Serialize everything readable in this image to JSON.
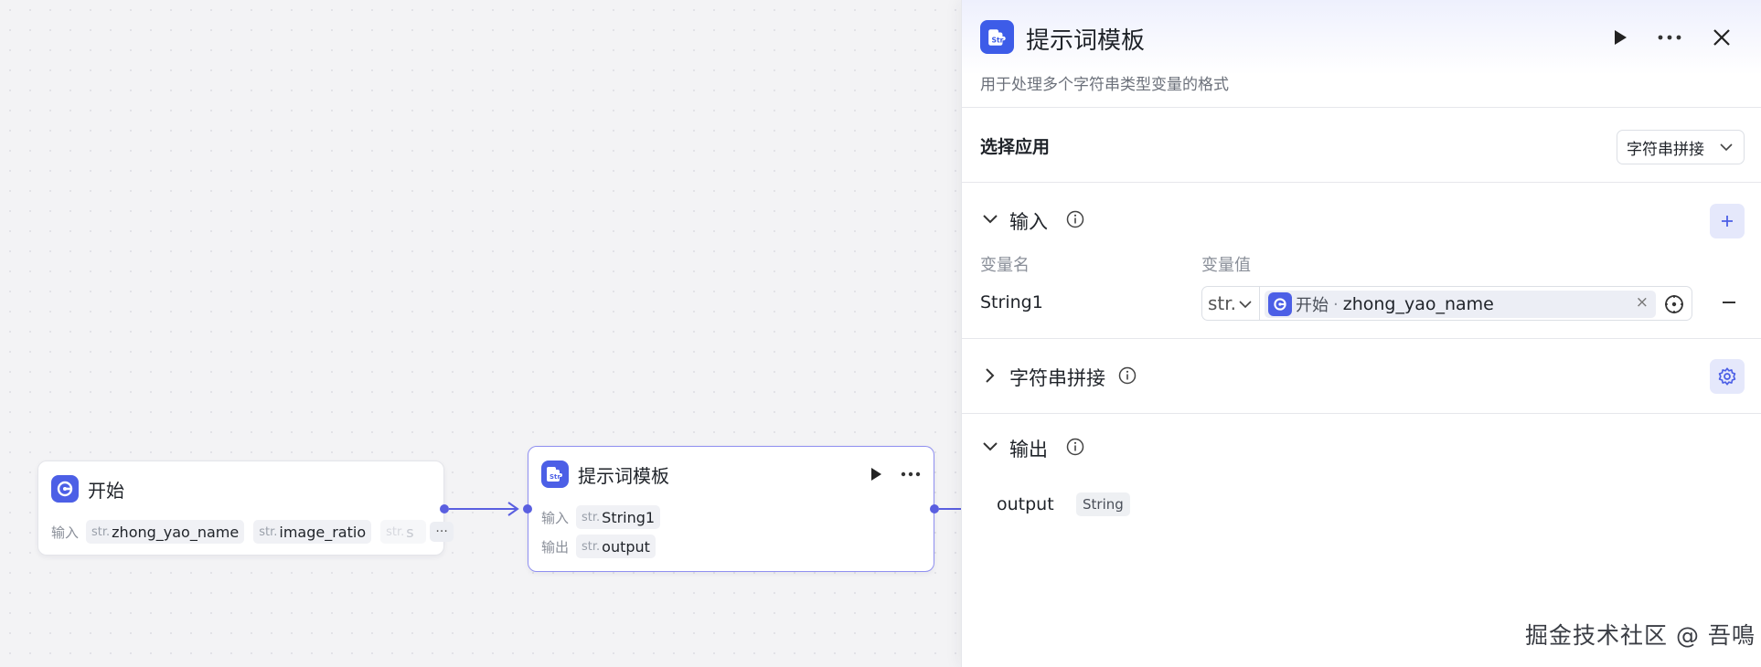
{
  "canvas": {
    "start_node": {
      "title": "开始",
      "input_label": "输入",
      "inputs": [
        {
          "type": "str.",
          "name": "zhong_yao_name"
        },
        {
          "type": "str.",
          "name": "image_ratio"
        },
        {
          "type": "str.",
          "name": "s"
        }
      ],
      "more_label": "···"
    },
    "template_node": {
      "title": "提示词模板",
      "input_label": "输入",
      "output_label": "输出",
      "input": {
        "type": "str.",
        "name": "String1"
      },
      "output": {
        "type": "str.",
        "name": "output"
      }
    }
  },
  "panel": {
    "title": "提示词模板",
    "description": "用于处理多个字符串类型变量的格式",
    "select_app": {
      "label": "选择应用",
      "value": "字符串拼接"
    },
    "input_section": {
      "title": "输入",
      "col_name": "变量名",
      "col_value": "变量值",
      "rows": [
        {
          "name": "String1",
          "type": "str.",
          "source": "开始",
          "separator": "·",
          "variable": "zhong_yao_name",
          "clear": "×"
        }
      ]
    },
    "concat_section": {
      "title": "字符串拼接"
    },
    "output_section": {
      "title": "输出",
      "rows": [
        {
          "name": "output",
          "type": "String"
        }
      ]
    }
  },
  "watermark": "掘金技术社区 @ 吾鳴",
  "colors": {
    "accent": "#4c5fe6",
    "edge": "#5a5fe0",
    "panel_header": "#eef0fd"
  }
}
